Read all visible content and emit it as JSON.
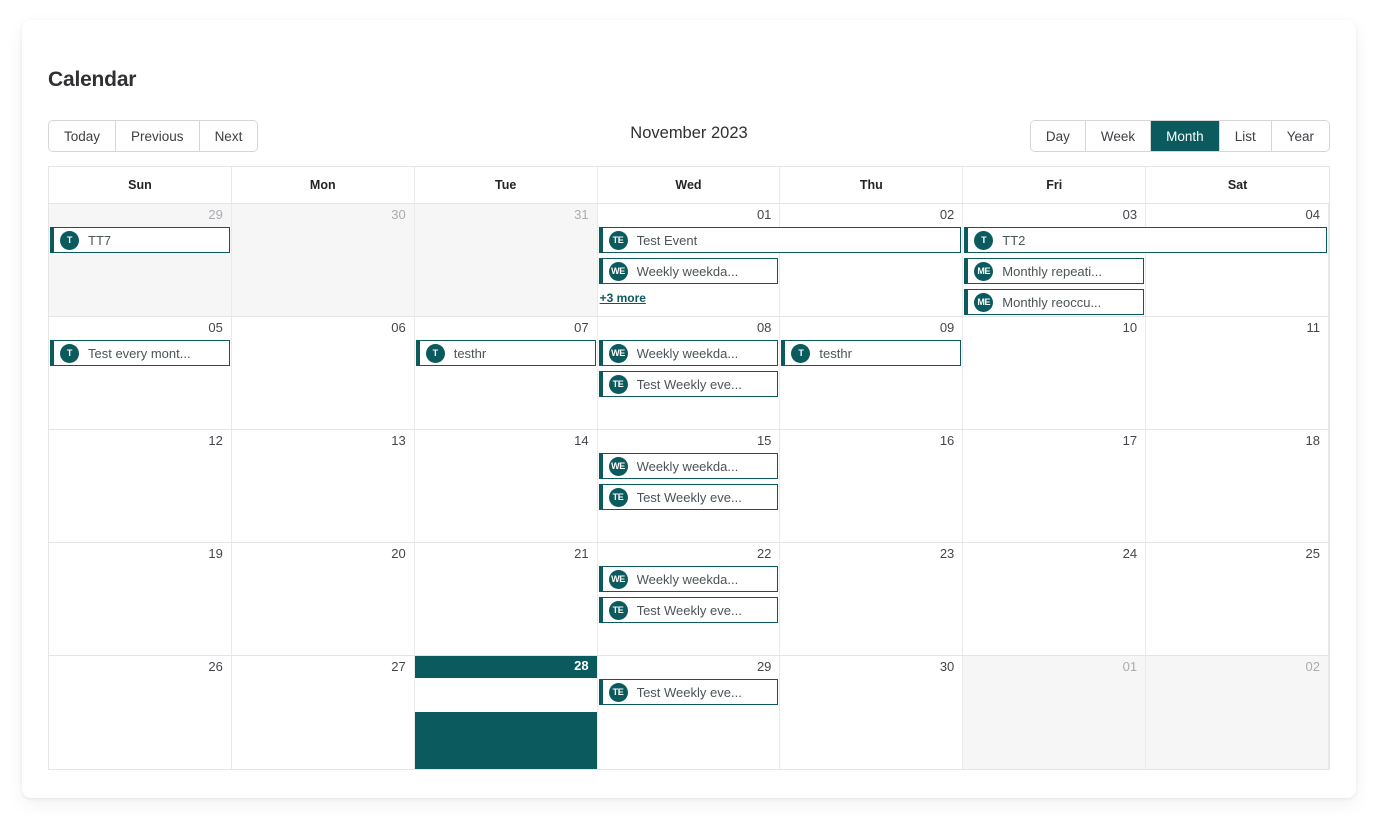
{
  "page_title": "Calendar",
  "toolbar": {
    "nav_buttons": [
      {
        "label": "Today",
        "name": "today-button"
      },
      {
        "label": "Previous",
        "name": "previous-button"
      },
      {
        "label": "Next",
        "name": "next-button"
      }
    ],
    "period_label": "November 2023",
    "view_buttons": [
      {
        "label": "Day",
        "name": "view-day-button",
        "active": false
      },
      {
        "label": "Week",
        "name": "view-week-button",
        "active": false
      },
      {
        "label": "Month",
        "name": "view-month-button",
        "active": true
      },
      {
        "label": "List",
        "name": "view-list-button",
        "active": false
      },
      {
        "label": "Year",
        "name": "view-year-button",
        "active": false
      }
    ]
  },
  "colors": {
    "accent": "#0b5a5e",
    "grid_border": "#e4e5e7",
    "other_month_bg": "#f6f6f7"
  },
  "weekdays": [
    "Sun",
    "Mon",
    "Tue",
    "Wed",
    "Thu",
    "Fri",
    "Sat"
  ],
  "weeks": [
    {
      "days": [
        {
          "num": "29",
          "other": true
        },
        {
          "num": "30",
          "other": true
        },
        {
          "num": "31",
          "other": true
        },
        {
          "num": "01",
          "other": false
        },
        {
          "num": "02",
          "other": false
        },
        {
          "num": "03",
          "other": false
        },
        {
          "num": "04",
          "other": false
        }
      ],
      "events": [
        {
          "title": "TT7",
          "initials": "T",
          "start": 0,
          "span": 1,
          "row": 0
        },
        {
          "title": "Test Event",
          "initials": "TE",
          "start": 3,
          "span": 2,
          "row": 0
        },
        {
          "title": "TT2",
          "initials": "T",
          "start": 5,
          "span": 2,
          "row": 0
        },
        {
          "title": "Weekly weekda...",
          "initials": "WE",
          "start": 3,
          "span": 1,
          "row": 1
        },
        {
          "title": "Monthly repeati...",
          "initials": "ME",
          "start": 5,
          "span": 1,
          "row": 1
        },
        {
          "title": "Monthly reoccu...",
          "initials": "ME",
          "start": 5,
          "span": 1,
          "row": 2
        }
      ],
      "more": [
        {
          "label": "+3 more",
          "col": 3
        }
      ]
    },
    {
      "days": [
        {
          "num": "05",
          "other": false
        },
        {
          "num": "06",
          "other": false
        },
        {
          "num": "07",
          "other": false
        },
        {
          "num": "08",
          "other": false
        },
        {
          "num": "09",
          "other": false
        },
        {
          "num": "10",
          "other": false
        },
        {
          "num": "11",
          "other": false
        }
      ],
      "events": [
        {
          "title": "Test every mont...",
          "initials": "T",
          "start": 0,
          "span": 1,
          "row": 0
        },
        {
          "title": "testhr",
          "initials": "T",
          "start": 2,
          "span": 1,
          "row": 0
        },
        {
          "title": "Weekly weekda...",
          "initials": "WE",
          "start": 3,
          "span": 1,
          "row": 0
        },
        {
          "title": "testhr",
          "initials": "T",
          "start": 4,
          "span": 1,
          "row": 0
        },
        {
          "title": "Test Weekly eve...",
          "initials": "TE",
          "start": 3,
          "span": 1,
          "row": 1
        }
      ],
      "more": []
    },
    {
      "days": [
        {
          "num": "12",
          "other": false
        },
        {
          "num": "13",
          "other": false
        },
        {
          "num": "14",
          "other": false
        },
        {
          "num": "15",
          "other": false
        },
        {
          "num": "16",
          "other": false
        },
        {
          "num": "17",
          "other": false
        },
        {
          "num": "18",
          "other": false
        }
      ],
      "events": [
        {
          "title": "Weekly weekda...",
          "initials": "WE",
          "start": 3,
          "span": 1,
          "row": 0
        },
        {
          "title": "Test Weekly eve...",
          "initials": "TE",
          "start": 3,
          "span": 1,
          "row": 1
        }
      ],
      "more": []
    },
    {
      "days": [
        {
          "num": "19",
          "other": false
        },
        {
          "num": "20",
          "other": false
        },
        {
          "num": "21",
          "other": false
        },
        {
          "num": "22",
          "other": false
        },
        {
          "num": "23",
          "other": false
        },
        {
          "num": "24",
          "other": false
        },
        {
          "num": "25",
          "other": false
        }
      ],
      "events": [
        {
          "title": "Weekly weekda...",
          "initials": "WE",
          "start": 3,
          "span": 1,
          "row": 0
        },
        {
          "title": "Test Weekly eve...",
          "initials": "TE",
          "start": 3,
          "span": 1,
          "row": 1
        }
      ],
      "more": []
    },
    {
      "days": [
        {
          "num": "26",
          "other": false
        },
        {
          "num": "27",
          "other": false
        },
        {
          "num": "28",
          "other": false,
          "today": true
        },
        {
          "num": "29",
          "other": false
        },
        {
          "num": "30",
          "other": false
        },
        {
          "num": "01",
          "other": true
        },
        {
          "num": "02",
          "other": true
        }
      ],
      "events": [
        {
          "title": "Test Weekly eve...",
          "initials": "TE",
          "start": 3,
          "span": 1,
          "row": 0
        }
      ],
      "more": []
    }
  ]
}
